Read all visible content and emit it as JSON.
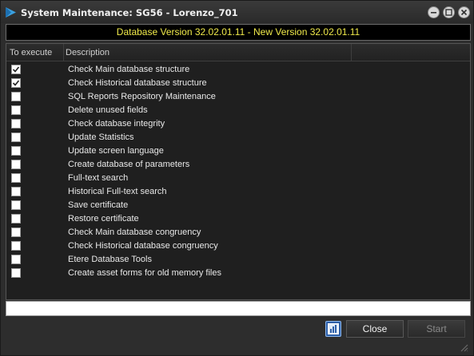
{
  "window": {
    "title": "System Maintenance: SG56 - Lorenzo_701"
  },
  "version": {
    "text": "Database Version 32.02.01.11 - New Version 32.02.01.11"
  },
  "grid": {
    "columns": [
      "To execute",
      "Description",
      ""
    ],
    "rows": [
      {
        "checked": true,
        "label": "Check Main database structure"
      },
      {
        "checked": true,
        "label": "Check Historical database structure"
      },
      {
        "checked": false,
        "label": "SQL Reports Repository Maintenance"
      },
      {
        "checked": false,
        "label": "Delete unused fields"
      },
      {
        "checked": false,
        "label": "Check database integrity"
      },
      {
        "checked": false,
        "label": "Update Statistics"
      },
      {
        "checked": false,
        "label": "Update screen language"
      },
      {
        "checked": false,
        "label": "Create database of parameters"
      },
      {
        "checked": false,
        "label": "Full-text search"
      },
      {
        "checked": false,
        "label": "Historical Full-text search"
      },
      {
        "checked": false,
        "label": "Save certificate"
      },
      {
        "checked": false,
        "label": "Restore certificate"
      },
      {
        "checked": false,
        "label": "Check Main database congruency"
      },
      {
        "checked": false,
        "label": "Check Historical database congruency"
      },
      {
        "checked": false,
        "label": "Etere Database Tools"
      },
      {
        "checked": false,
        "label": "Create asset forms for old memory files"
      }
    ]
  },
  "footer": {
    "close_label": "Close",
    "start_label": "Start"
  },
  "colors": {
    "version_text": "#f0ea4a",
    "help_button": "#2d5fa8"
  },
  "icons": {
    "app": "app-logo-icon",
    "help": "chart-help-icon",
    "grip": "resize-grip-icon"
  }
}
